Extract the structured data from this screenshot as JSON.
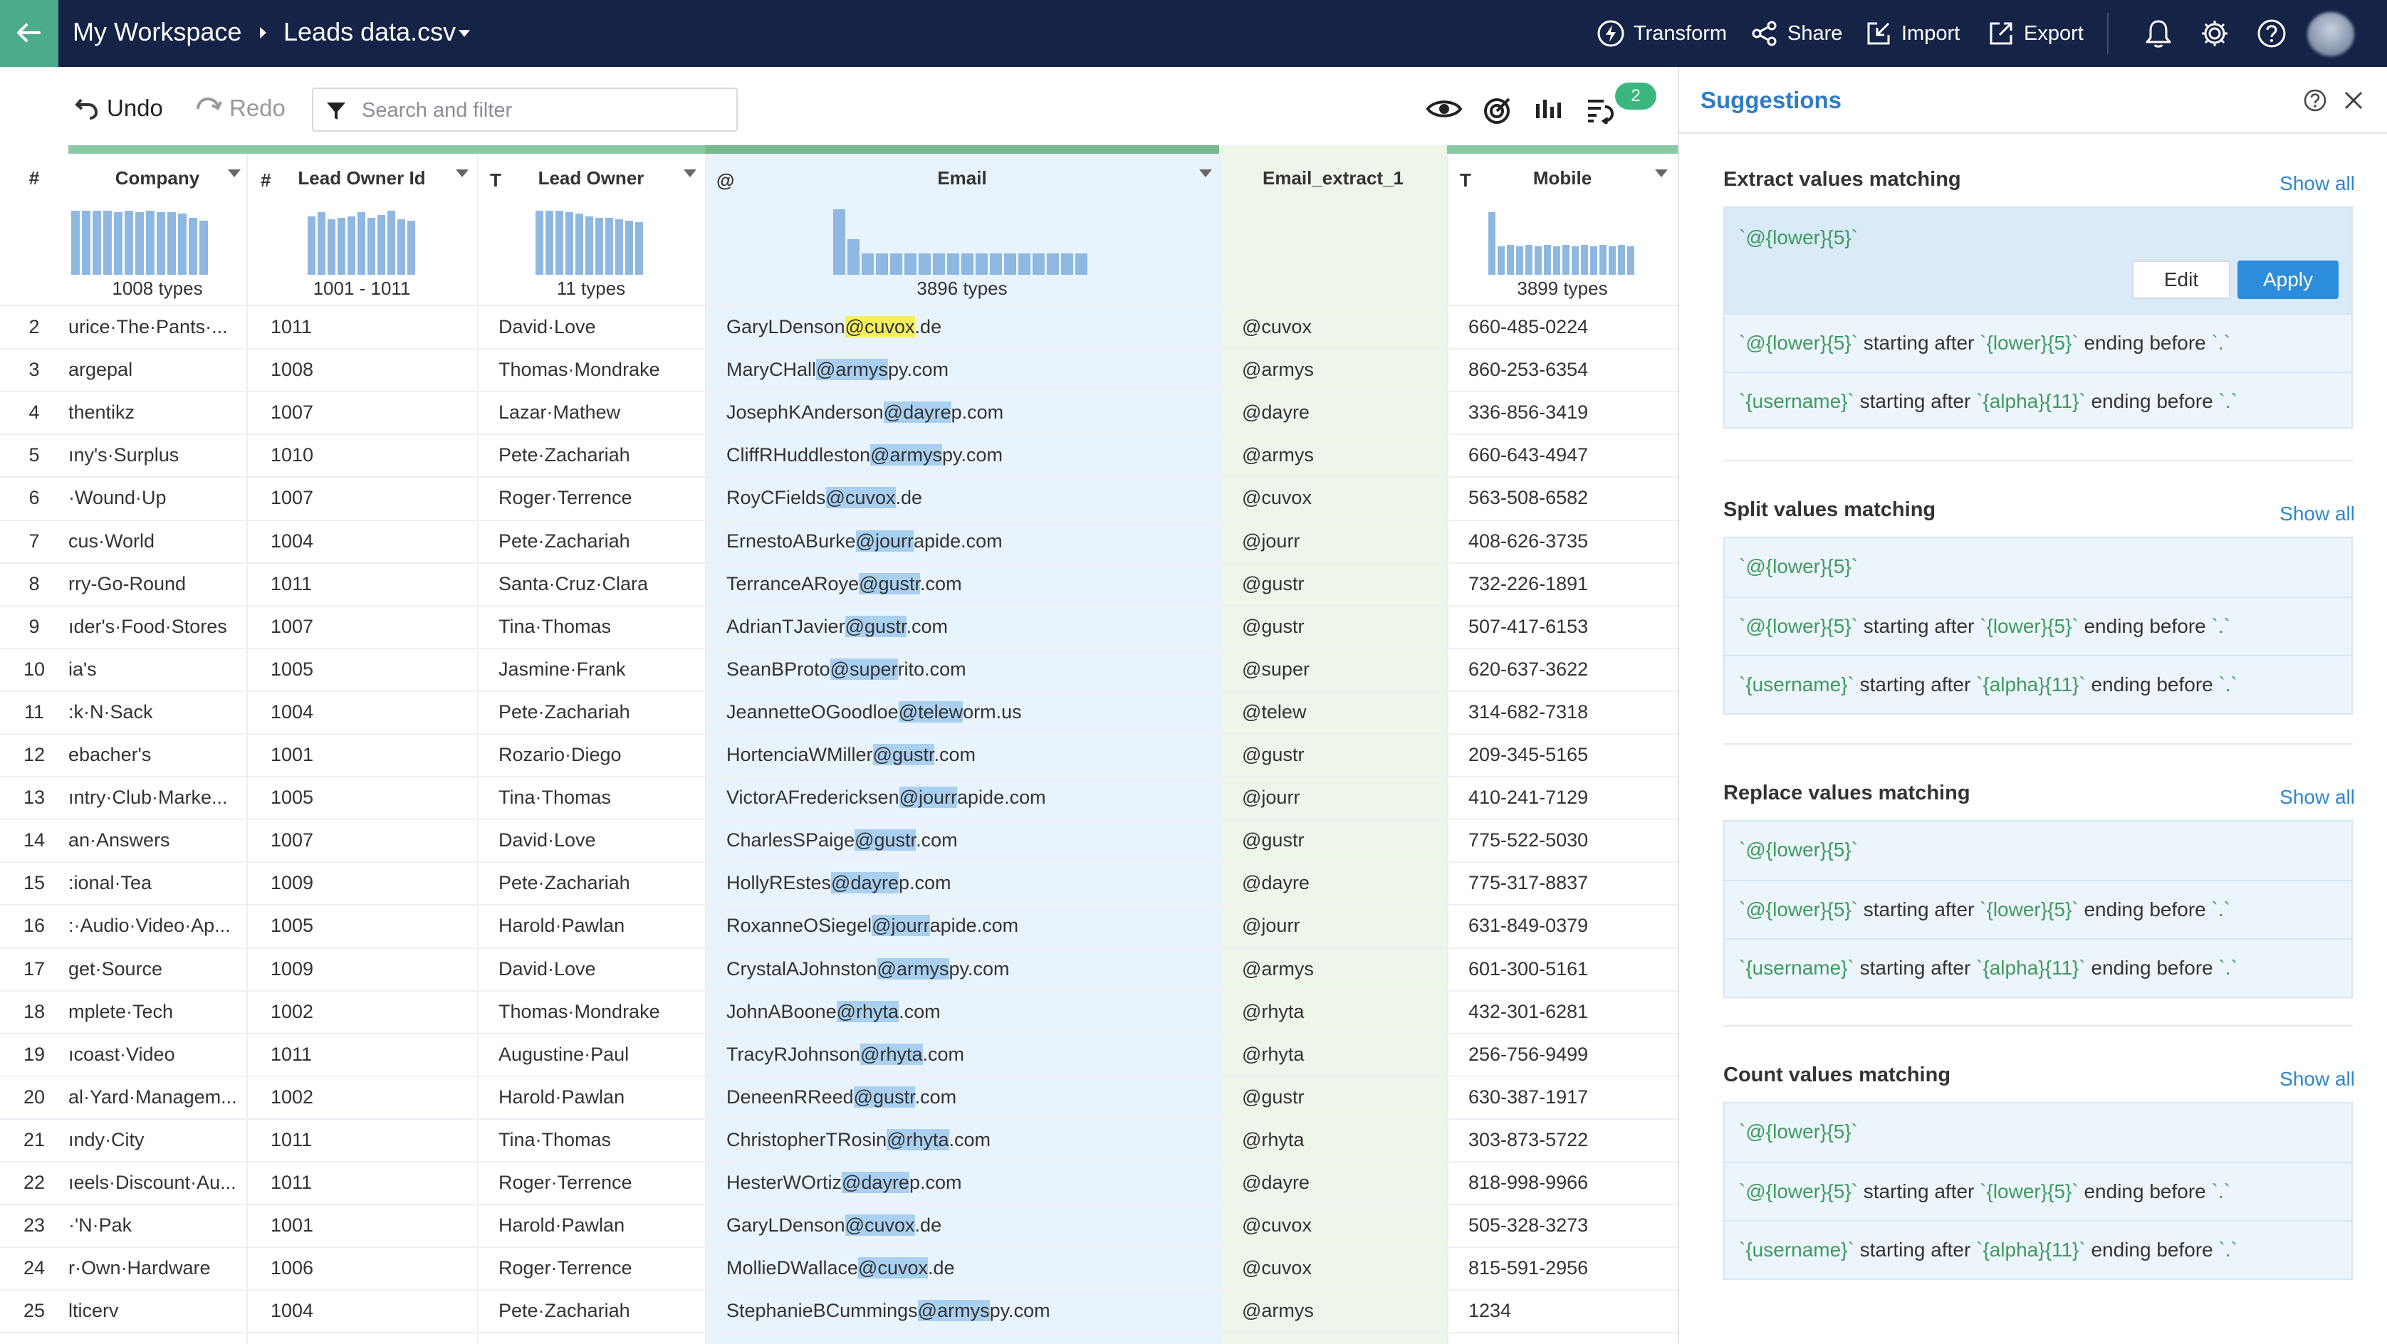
{
  "breadcrumb": {
    "workspace": "My Workspace",
    "file": "Leads data.csv"
  },
  "top_actions": {
    "transform": "Transform",
    "share": "Share",
    "import": "Import",
    "export": "Export"
  },
  "toolbar": {
    "undo": "Undo",
    "redo": "Redo",
    "search_placeholder": "Search and filter",
    "badge_count": "2"
  },
  "columns": {
    "rownum": "#",
    "company": {
      "label": "Company",
      "type": "",
      "summary": "1008 types"
    },
    "lead_owner_id": {
      "label": "Lead Owner Id",
      "type": "#",
      "summary": "1001 - 1011"
    },
    "lead_owner": {
      "label": "Lead Owner",
      "type": "T",
      "summary": "11 types"
    },
    "email": {
      "label": "Email",
      "type": "@",
      "summary": "3896 types"
    },
    "email_extract": {
      "label": "Email_extract_1",
      "type": "",
      "summary": ""
    },
    "mobile": {
      "label": "Mobile",
      "type": "T",
      "summary": "3899 types"
    }
  },
  "rows": [
    {
      "n": "2",
      "company": "urice·The·Pants·...",
      "id": "1011",
      "owner": "David·Love",
      "email": [
        "GaryLDenson",
        "@cuvox",
        ".de"
      ],
      "ext": "@cuvox",
      "mobile": "660-485-0224"
    },
    {
      "n": "3",
      "company": "argepal",
      "id": "1008",
      "owner": "Thomas·Mondrake",
      "email": [
        "MaryCHall",
        "@armys",
        "py.com"
      ],
      "ext": "@armys",
      "mobile": "860-253-6354"
    },
    {
      "n": "4",
      "company": "thentikz",
      "id": "1007",
      "owner": "Lazar·Mathew",
      "email": [
        "JosephKAnderson",
        "@dayre",
        "p.com"
      ],
      "ext": "@dayre",
      "mobile": "336-856-3419"
    },
    {
      "n": "5",
      "company": "ıny's·Surplus",
      "id": "1010",
      "owner": "Pete·Zachariah",
      "email": [
        "CliffRHuddleston",
        "@armys",
        "py.com"
      ],
      "ext": "@armys",
      "mobile": "660-643-4947"
    },
    {
      "n": "6",
      "company": "·Wound·Up",
      "id": "1007",
      "owner": "Roger·Terrence",
      "email": [
        "RoyCFields",
        "@cuvox",
        ".de"
      ],
      "ext": "@cuvox",
      "mobile": "563-508-6582"
    },
    {
      "n": "7",
      "company": "cus·World",
      "id": "1004",
      "owner": "Pete·Zachariah",
      "email": [
        "ErnestoABurke",
        "@jourr",
        "apide.com"
      ],
      "ext": "@jourr",
      "mobile": "408-626-3735"
    },
    {
      "n": "8",
      "company": "rry-Go-Round",
      "id": "1011",
      "owner": "Santa·Cruz·Clara",
      "email": [
        "TerranceARoye",
        "@gustr",
        ".com"
      ],
      "ext": "@gustr",
      "mobile": "732-226-1891"
    },
    {
      "n": "9",
      "company": "ıder's·Food·Stores",
      "id": "1007",
      "owner": "Tina·Thomas",
      "email": [
        "AdrianTJavier",
        "@gustr",
        ".com"
      ],
      "ext": "@gustr",
      "mobile": "507-417-6153"
    },
    {
      "n": "10",
      "company": "ia's",
      "id": "1005",
      "owner": "Jasmine·Frank",
      "email": [
        "SeanBProto",
        "@super",
        "rito.com"
      ],
      "ext": "@super",
      "mobile": "620-637-3622"
    },
    {
      "n": "11",
      "company": ":k·N·Sack",
      "id": "1004",
      "owner": "Pete·Zachariah",
      "email": [
        "JeannetteOGoodloe",
        "@telew",
        "orm.us"
      ],
      "ext": "@telew",
      "mobile": "314-682-7318"
    },
    {
      "n": "12",
      "company": "ebacher's",
      "id": "1001",
      "owner": "Rozario·Diego",
      "email": [
        "HortenciaWMiller",
        "@gustr",
        ".com"
      ],
      "ext": "@gustr",
      "mobile": "209-345-5165"
    },
    {
      "n": "13",
      "company": "ıntry·Club·Marke...",
      "id": "1005",
      "owner": "Tina·Thomas",
      "email": [
        "VictorAFredericksen",
        "@jourr",
        "apide.com"
      ],
      "ext": "@jourr",
      "mobile": "410-241-7129"
    },
    {
      "n": "14",
      "company": "an·Answers",
      "id": "1007",
      "owner": "David·Love",
      "email": [
        "CharlesSPaige",
        "@gustr",
        ".com"
      ],
      "ext": "@gustr",
      "mobile": "775-522-5030"
    },
    {
      "n": "15",
      "company": ":ional·Tea",
      "id": "1009",
      "owner": "Pete·Zachariah",
      "email": [
        "HollyREstes",
        "@dayre",
        "p.com"
      ],
      "ext": "@dayre",
      "mobile": "775-317-8837"
    },
    {
      "n": "16",
      "company": ":·Audio·Video·Ap...",
      "id": "1005",
      "owner": "Harold·Pawlan",
      "email": [
        "RoxanneOSiegel",
        "@jourr",
        "apide.com"
      ],
      "ext": "@jourr",
      "mobile": "631-849-0379"
    },
    {
      "n": "17",
      "company": "get·Source",
      "id": "1009",
      "owner": "David·Love",
      "email": [
        "CrystalAJohnston",
        "@armys",
        "py.com"
      ],
      "ext": "@armys",
      "mobile": "601-300-5161"
    },
    {
      "n": "18",
      "company": "mplete·Tech",
      "id": "1002",
      "owner": "Thomas·Mondrake",
      "email": [
        "JohnABoone",
        "@rhyta",
        ".com"
      ],
      "ext": "@rhyta",
      "mobile": "432-301-6281"
    },
    {
      "n": "19",
      "company": "ıcoast·Video",
      "id": "1011",
      "owner": "Augustine·Paul",
      "email": [
        "TracyRJohnson",
        "@rhyta",
        ".com"
      ],
      "ext": "@rhyta",
      "mobile": "256-756-9499"
    },
    {
      "n": "20",
      "company": "al·Yard·Managem...",
      "id": "1002",
      "owner": "Harold·Pawlan",
      "email": [
        "DeneenRReed",
        "@gustr",
        ".com"
      ],
      "ext": "@gustr",
      "mobile": "630-387-1917"
    },
    {
      "n": "21",
      "company": "ındy·City",
      "id": "1011",
      "owner": "Tina·Thomas",
      "email": [
        "ChristopherTRosin",
        "@rhyta",
        ".com"
      ],
      "ext": "@rhyta",
      "mobile": "303-873-5722"
    },
    {
      "n": "22",
      "company": "ıeels·Discount·Au...",
      "id": "1011",
      "owner": "Roger·Terrence",
      "email": [
        "HesterWOrtiz",
        "@dayre",
        "p.com"
      ],
      "ext": "@dayre",
      "mobile": "818-998-9966"
    },
    {
      "n": "23",
      "company": "·'N·Pak",
      "id": "1001",
      "owner": "Harold·Pawlan",
      "email": [
        "GaryLDenson",
        "@cuvox",
        ".de"
      ],
      "ext": "@cuvox",
      "mobile": "505-328-3273"
    },
    {
      "n": "24",
      "company": "r·Own·Hardware",
      "id": "1006",
      "owner": "Roger·Terrence",
      "email": [
        "MollieDWallace",
        "@cuvox",
        ".de"
      ],
      "ext": "@cuvox",
      "mobile": "815-591-2956"
    },
    {
      "n": "25",
      "company": "lticerv",
      "id": "1004",
      "owner": "Pete·Zachariah",
      "email": [
        "StephanieBCummings",
        "@armys",
        "py.com"
      ],
      "ext": "@armys",
      "mobile": "1234"
    }
  ],
  "panel": {
    "title": "Suggestions",
    "show_all": "Show all",
    "edit": "Edit",
    "apply": "Apply",
    "pattern": "`@{lower}{5}`",
    "word_starting_after": " starting after ",
    "word_ending_before": " ending before ",
    "after_lower": "`{lower}{5}`",
    "username": "`{username}`",
    "after_alpha": "`{alpha}{11}`",
    "end_dot": "`.`",
    "sections": [
      {
        "title": "Extract values matching"
      },
      {
        "title": "Split values matching"
      },
      {
        "title": "Replace values matching"
      },
      {
        "title": "Count values matching"
      }
    ]
  },
  "colors": {
    "topbar": "#142346",
    "accent_green": "#4cab8d",
    "link_blue": "#2e86d1",
    "highlight": "#a9d0f1",
    "highlight_yellow": "#f3f05a"
  },
  "icons": [
    "back-arrow-icon",
    "breadcrumb-arrow-icon",
    "dropdown-icon",
    "transform-icon",
    "share-icon",
    "import-icon",
    "export-icon",
    "bell-icon",
    "gear-icon",
    "help-icon",
    "undo-icon",
    "redo-icon",
    "filter-icon",
    "eye-icon",
    "target-icon",
    "chart-icon",
    "rules-icon",
    "close-icon"
  ]
}
